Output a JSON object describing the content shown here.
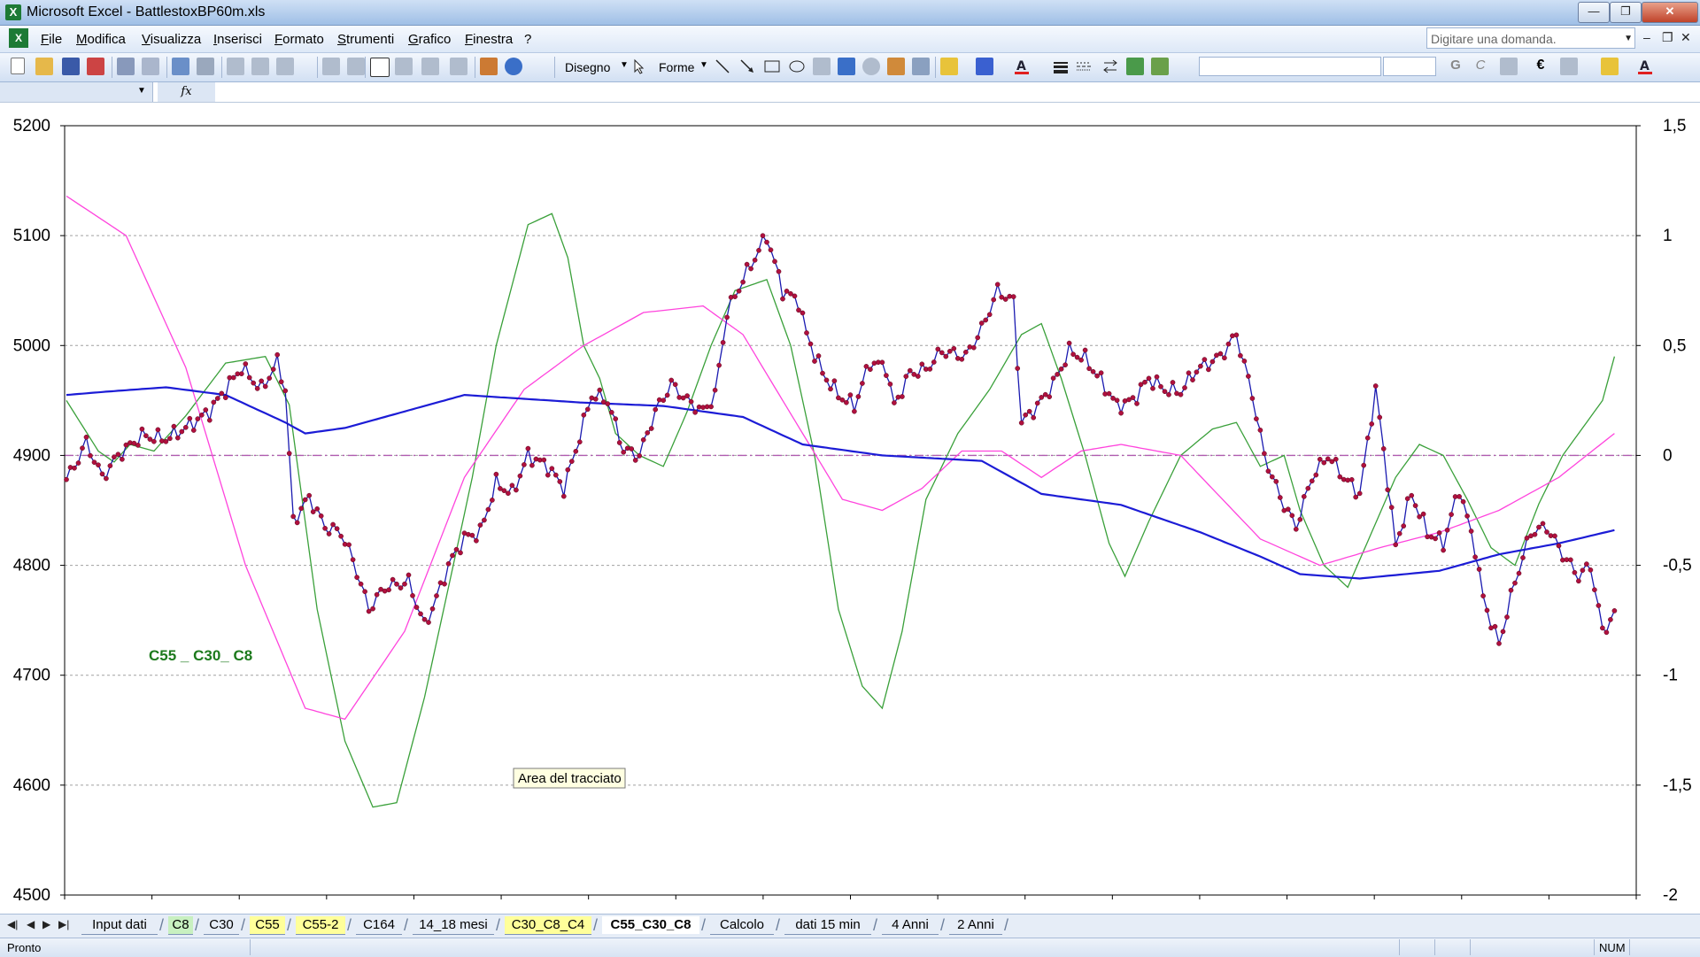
{
  "window": {
    "app_title": "Microsoft Excel - BattlestoxBP60m.xls"
  },
  "menu": {
    "items": [
      "File",
      "Modifica",
      "Visualizza",
      "Inserisci",
      "Formato",
      "Strumenti",
      "Grafico",
      "Finestra",
      "?"
    ],
    "ask_placeholder": "Digitare una domanda."
  },
  "toolbar": {
    "draw_label": "Disegno",
    "shapes_label": "Forme"
  },
  "sheet_tabs": {
    "tabs": [
      {
        "label": "Input dati",
        "color": "none"
      },
      {
        "label": "C8",
        "color": "green"
      },
      {
        "label": "C30",
        "color": "none"
      },
      {
        "label": "C55",
        "color": "yellow"
      },
      {
        "label": "C55-2",
        "color": "yellow"
      },
      {
        "label": "C164",
        "color": "none"
      },
      {
        "label": "14_18 mesi",
        "color": "none"
      },
      {
        "label": "C30_C8_C4",
        "color": "yellow"
      },
      {
        "label": "C55_C30_C8",
        "color": "active"
      },
      {
        "label": "Calcolo",
        "color": "none"
      },
      {
        "label": "dati 15 min",
        "color": "none"
      },
      {
        "label": "4 Anni",
        "color": "none"
      },
      {
        "label": "2 Anni",
        "color": "none"
      }
    ]
  },
  "statusbar": {
    "status": "Pronto",
    "num_indicator": "NUM"
  },
  "chart_data": {
    "type": "line",
    "title": "C55 _ C30_ C8",
    "tooltip": "Area del tracciato",
    "left_axis": {
      "ylim": [
        4500,
        5200
      ],
      "ticks": [
        "5200",
        "5100",
        "5000",
        "4900",
        "4800",
        "4700",
        "4600",
        "4500"
      ]
    },
    "right_axis": {
      "ylim": [
        -2,
        1.5
      ],
      "ticks": [
        "1,5",
        "1",
        "0,5",
        "0",
        "-0,5",
        "-1",
        "-1,5",
        "-2"
      ]
    },
    "x_count": 220,
    "grid": true,
    "colors": {
      "price": "#1a1ab0",
      "price_marker": "#b0103e",
      "c55": "#1c1cd6",
      "c30": "#ff44dd",
      "c8": "#3aa03a",
      "zero": "#b05cb0"
    },
    "series": [
      {
        "axis": "left",
        "role": "price",
        "markers": true,
        "keyframes": [
          [
            0,
            4878
          ],
          [
            2,
            4890
          ],
          [
            5,
            4912
          ],
          [
            9,
            4880
          ],
          [
            13,
            4900
          ],
          [
            19,
            4918
          ],
          [
            25,
            4915
          ],
          [
            30,
            4925
          ],
          [
            36,
            4940
          ],
          [
            40,
            4960
          ],
          [
            44,
            4980
          ],
          [
            49,
            4960
          ],
          [
            53,
            4985
          ],
          [
            55,
            4960
          ],
          [
            57,
            4840
          ],
          [
            61,
            4862
          ],
          [
            65,
            4835
          ],
          [
            69,
            4830
          ],
          [
            72,
            4805
          ],
          [
            76,
            4760
          ],
          [
            80,
            4780
          ],
          [
            86,
            4785
          ],
          [
            90,
            4745
          ],
          [
            93,
            4770
          ],
          [
            96,
            4800
          ],
          [
            100,
            4825
          ],
          [
            104,
            4830
          ],
          [
            108,
            4875
          ],
          [
            112,
            4865
          ],
          [
            116,
            4900
          ],
          [
            121,
            4890
          ],
          [
            125,
            4870
          ],
          [
            128,
            4905
          ],
          [
            132,
            4955
          ],
          [
            136,
            4950
          ],
          [
            140,
            4905
          ],
          [
            144,
            4900
          ],
          [
            148,
            4940
          ],
          [
            152,
            4965
          ],
          [
            156,
            4950
          ],
          [
            160,
            4940
          ],
          [
            163,
            4955
          ],
          [
            166,
            5030
          ],
          [
            170,
            5060
          ],
          [
            176,
            5100
          ],
          [
            180,
            5050
          ],
          [
            184,
            5040
          ],
          [
            186,
            5010
          ],
          [
            190,
            4975
          ],
          [
            194,
            4955
          ],
          [
            198,
            4945
          ],
          [
            202,
            4985
          ],
          [
            206,
            4980
          ],
          [
            208,
            4945
          ],
          [
            212,
            4975
          ],
          [
            216,
            4978
          ],
          [
            220,
            4995
          ],
          [
            226,
            4990
          ],
          [
            230,
            5015
          ],
          [
            234,
            5050
          ],
          [
            238,
            5040
          ],
          [
            240,
            4930
          ],
          [
            244,
            4945
          ],
          [
            248,
            4965
          ],
          [
            252,
            4995
          ],
          [
            256,
            4988
          ],
          [
            260,
            4968
          ],
          [
            264,
            4945
          ],
          [
            268,
            4950
          ],
          [
            272,
            4970
          ],
          [
            276,
            4960
          ],
          [
            280,
            4958
          ],
          [
            284,
            4978
          ],
          [
            290,
            4990
          ],
          [
            294,
            5010
          ],
          [
            298,
            4955
          ],
          [
            301,
            4900
          ],
          [
            305,
            4862
          ],
          [
            309,
            4835
          ],
          [
            313,
            4880
          ],
          [
            317,
            4900
          ],
          [
            321,
            4880
          ],
          [
            325,
            4865
          ],
          [
            329,
            4960
          ],
          [
            331,
            4905
          ],
          [
            334,
            4818
          ],
          [
            338,
            4865
          ],
          [
            342,
            4830
          ],
          [
            346,
            4820
          ],
          [
            350,
            4870
          ],
          [
            354,
            4815
          ],
          [
            356,
            4770
          ],
          [
            360,
            4728
          ],
          [
            364,
            4785
          ],
          [
            368,
            4830
          ],
          [
            372,
            4835
          ],
          [
            376,
            4810
          ],
          [
            380,
            4790
          ],
          [
            383,
            4800
          ],
          [
            386,
            4740
          ],
          [
            389,
            4755
          ]
        ]
      },
      {
        "axis": "left",
        "role": "c55",
        "keyframes": [
          [
            0,
            4955
          ],
          [
            10,
            4958
          ],
          [
            25,
            4962
          ],
          [
            40,
            4955
          ],
          [
            55,
            4930
          ],
          [
            60,
            4920
          ],
          [
            70,
            4925
          ],
          [
            90,
            4945
          ],
          [
            100,
            4955
          ],
          [
            130,
            4948
          ],
          [
            150,
            4945
          ],
          [
            170,
            4935
          ],
          [
            185,
            4910
          ],
          [
            205,
            4900
          ],
          [
            230,
            4895
          ],
          [
            245,
            4865
          ],
          [
            265,
            4855
          ],
          [
            285,
            4830
          ],
          [
            300,
            4808
          ],
          [
            310,
            4792
          ],
          [
            325,
            4788
          ],
          [
            345,
            4795
          ],
          [
            360,
            4810
          ],
          [
            375,
            4820
          ],
          [
            389,
            4832
          ]
        ]
      },
      {
        "axis": "right",
        "role": "c30",
        "keyframes": [
          [
            0,
            1.18
          ],
          [
            15,
            1
          ],
          [
            30,
            0.4
          ],
          [
            45,
            -0.5
          ],
          [
            60,
            -1.15
          ],
          [
            70,
            -1.2
          ],
          [
            85,
            -0.8
          ],
          [
            100,
            -0.1
          ],
          [
            115,
            0.3
          ],
          [
            130,
            0.5
          ],
          [
            145,
            0.65
          ],
          [
            160,
            0.68
          ],
          [
            170,
            0.55
          ],
          [
            185,
            0.1
          ],
          [
            195,
            -0.2
          ],
          [
            205,
            -0.25
          ],
          [
            215,
            -0.15
          ],
          [
            225,
            0.02
          ],
          [
            235,
            0.02
          ],
          [
            245,
            -0.1
          ],
          [
            255,
            0.02
          ],
          [
            265,
            0.05
          ],
          [
            280,
            0.0
          ],
          [
            300,
            -0.38
          ],
          [
            315,
            -0.5
          ],
          [
            330,
            -0.42
          ],
          [
            345,
            -0.35
          ],
          [
            360,
            -0.25
          ],
          [
            375,
            -0.1
          ],
          [
            389,
            0.1
          ]
        ]
      },
      {
        "axis": "right",
        "role": "c8",
        "keyframes": [
          [
            0,
            0.25
          ],
          [
            8,
            0.02
          ],
          [
            12,
            -0.03
          ],
          [
            16,
            0.05
          ],
          [
            22,
            0.02
          ],
          [
            30,
            0.18
          ],
          [
            40,
            0.42
          ],
          [
            50,
            0.45
          ],
          [
            56,
            0.23
          ],
          [
            63,
            -0.7
          ],
          [
            70,
            -1.3
          ],
          [
            77,
            -1.6
          ],
          [
            83,
            -1.58
          ],
          [
            90,
            -1.1
          ],
          [
            96,
            -0.6
          ],
          [
            102,
            -0.1
          ],
          [
            108,
            0.5
          ],
          [
            116,
            1.05
          ],
          [
            122,
            1.1
          ],
          [
            126,
            0.9
          ],
          [
            130,
            0.5
          ],
          [
            134,
            0.35
          ],
          [
            138,
            0.1
          ],
          [
            144,
            0.0
          ],
          [
            150,
            -0.05
          ],
          [
            156,
            0.2
          ],
          [
            162,
            0.5
          ],
          [
            168,
            0.75
          ],
          [
            176,
            0.8
          ],
          [
            182,
            0.5
          ],
          [
            188,
            0.0
          ],
          [
            194,
            -0.7
          ],
          [
            200,
            -1.05
          ],
          [
            205,
            -1.15
          ],
          [
            210,
            -0.8
          ],
          [
            216,
            -0.2
          ],
          [
            224,
            0.1
          ],
          [
            232,
            0.3
          ],
          [
            240,
            0.55
          ],
          [
            245,
            0.6
          ],
          [
            250,
            0.35
          ],
          [
            256,
            0.0
          ],
          [
            262,
            -0.4
          ],
          [
            266,
            -0.55
          ],
          [
            272,
            -0.3
          ],
          [
            280,
            0.0
          ],
          [
            288,
            0.12
          ],
          [
            294,
            0.15
          ],
          [
            300,
            -0.05
          ],
          [
            306,
            0.0
          ],
          [
            310,
            -0.25
          ],
          [
            316,
            -0.5
          ],
          [
            322,
            -0.6
          ],
          [
            328,
            -0.35
          ],
          [
            334,
            -0.1
          ],
          [
            340,
            0.05
          ],
          [
            346,
            0.0
          ],
          [
            352,
            -0.2
          ],
          [
            358,
            -0.42
          ],
          [
            364,
            -0.5
          ],
          [
            370,
            -0.22
          ],
          [
            376,
            0.0
          ],
          [
            382,
            0.15
          ],
          [
            386,
            0.25
          ],
          [
            389,
            0.45
          ]
        ]
      }
    ]
  }
}
